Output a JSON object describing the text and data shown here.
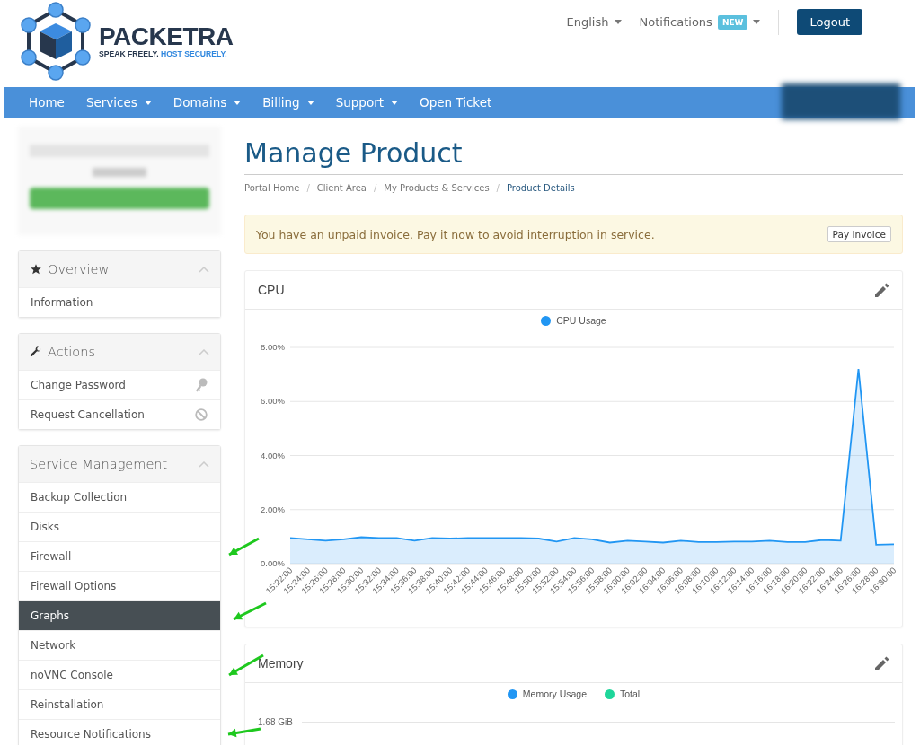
{
  "logo": {
    "name": "PACKETRA",
    "tagline_parts": [
      "SPEAK FREELY.",
      "HOST SECURELY."
    ]
  },
  "top_links": [
    {
      "label": "English"
    },
    {
      "label": "Notifications",
      "badge": "NEW"
    }
  ],
  "logout": "Logout",
  "nav": [
    {
      "label": "Home",
      "dropdown": false
    },
    {
      "label": "Services",
      "dropdown": true
    },
    {
      "label": "Domains",
      "dropdown": true
    },
    {
      "label": "Billing",
      "dropdown": true
    },
    {
      "label": "Support",
      "dropdown": true
    },
    {
      "label": "Open Ticket",
      "dropdown": false
    }
  ],
  "sidebar": [
    {
      "title": "Overview",
      "items": [
        {
          "label": "Information",
          "selected": false
        }
      ]
    },
    {
      "title": "Actions",
      "items": [
        {
          "label": "Change Password",
          "selected": false
        },
        {
          "label": "Request Cancellation",
          "selected": false
        }
      ]
    },
    {
      "title": "Service Management",
      "items": [
        {
          "label": "Backup Collection",
          "selected": false
        },
        {
          "label": "Disks",
          "selected": false
        },
        {
          "label": "Firewall",
          "selected": false
        },
        {
          "label": "Firewall Options",
          "selected": false
        },
        {
          "label": "Graphs",
          "selected": true
        },
        {
          "label": "Network",
          "selected": false
        },
        {
          "label": "noVNC Console",
          "selected": false
        },
        {
          "label": "Reinstallation",
          "selected": false
        },
        {
          "label": "Resource Notifications",
          "selected": false
        }
      ]
    }
  ],
  "page_title": "Manage Product",
  "breadcrumb": [
    {
      "label": "Portal Home",
      "current": false
    },
    {
      "separator": "/"
    },
    {
      "label": "Client Area",
      "current": false
    },
    {
      "separator": "/"
    },
    {
      "label": "My Products & Services",
      "current": false
    },
    {
      "separator": "/"
    },
    {
      "label": "Product Details",
      "current": true
    }
  ],
  "alert": {
    "text": "You have an unpaid invoice. Pay it now to avoid interruption in service.",
    "button": "Pay Invoice"
  },
  "cpu_card": {
    "title": "CPU",
    "chart_data": {
      "type": "area",
      "categories": [
        "15:22:00",
        "15:24:00",
        "15:26:00",
        "15:28:00",
        "15:30:00",
        "15:32:00",
        "15:34:00",
        "15:36:00",
        "15:38:00",
        "15:40:00",
        "15:42:00",
        "15:44:00",
        "15:46:00",
        "15:48:00",
        "15:50:00",
        "15:52:00",
        "15:54:00",
        "15:56:00",
        "15:58:00",
        "16:00:00",
        "16:02:00",
        "16:04:00",
        "16:06:00",
        "16:08:00",
        "16:10:00",
        "16:12:00",
        "16:14:00",
        "16:16:00",
        "16:18:00",
        "16:20:00",
        "16:22:00",
        "16:24:00",
        "16:26:00",
        "16:28:00",
        "16:30:00"
      ],
      "series": [
        {
          "name": "CPU Usage",
          "color": "#2196f3",
          "values": [
            0.95,
            0.9,
            0.85,
            0.9,
            0.98,
            0.95,
            0.95,
            0.85,
            0.95,
            0.93,
            0.95,
            0.95,
            0.95,
            0.95,
            0.93,
            0.82,
            0.95,
            0.9,
            0.78,
            0.85,
            0.82,
            0.78,
            0.85,
            0.8,
            0.8,
            0.82,
            0.82,
            0.85,
            0.8,
            0.8,
            0.88,
            0.85,
            7.2,
            0.7,
            0.72
          ]
        }
      ],
      "grid": true,
      "ylim": [
        0,
        8
      ],
      "yticks": [
        {
          "value": 0,
          "label": "0.00%"
        },
        {
          "value": 2,
          "label": "2.00%"
        },
        {
          "value": 4,
          "label": "4.00%"
        },
        {
          "value": 6,
          "label": "6.00%"
        },
        {
          "value": 8,
          "label": "8.00%"
        }
      ]
    }
  },
  "memory_card": {
    "title": "Memory",
    "legend": [
      {
        "label": "Memory Usage",
        "color": "#2196f3"
      },
      {
        "label": "Total",
        "color": "#1ed69a"
      }
    ],
    "top_tick": "1.68 GiB"
  }
}
